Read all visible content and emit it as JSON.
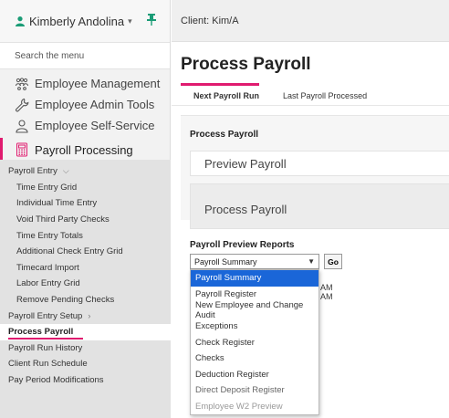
{
  "sidebar": {
    "user_name": "Kimberly Andolina",
    "search_label": "Search the menu",
    "main_items": [
      {
        "label": "Employee Management"
      },
      {
        "label": "Employee Admin Tools"
      },
      {
        "label": "Employee Self-Service"
      },
      {
        "label": "Payroll Processing"
      }
    ],
    "sub_items": [
      {
        "label": "Payroll Entry"
      },
      {
        "label": "Time Entry Grid"
      },
      {
        "label": "Individual Time Entry"
      },
      {
        "label": "Void Third Party Checks"
      },
      {
        "label": "Time Entry Totals"
      },
      {
        "label": "Additional Check Entry Grid"
      },
      {
        "label": "Timecard Import"
      },
      {
        "label": "Labor Entry Grid"
      },
      {
        "label": "Remove Pending Checks"
      },
      {
        "label": "Payroll Entry Setup"
      },
      {
        "label": "Process Payroll"
      },
      {
        "label": "Payroll Run History"
      },
      {
        "label": "Client Run Schedule"
      },
      {
        "label": "Pay Period Modifications"
      }
    ]
  },
  "main": {
    "client": "Client: Kim/A",
    "page_title": "Process Payroll",
    "tabs": [
      {
        "label": "Next Payroll Run"
      },
      {
        "label": "Last Payroll Processed"
      }
    ],
    "section_title": "Process Payroll",
    "preview_button": "Preview Payroll",
    "process_button": "Process Payroll",
    "reports_title": "Payroll Preview Reports",
    "selected_report": "Payroll Summary",
    "go_label": "Go",
    "time_suffix_1": "AM",
    "time_suffix_2": "AM",
    "dropdown_options": [
      {
        "label": "Payroll Summary"
      },
      {
        "label": "Payroll Register"
      },
      {
        "label": "New Employee and Change Audit"
      },
      {
        "label": "Exceptions"
      },
      {
        "label": "Check Register"
      },
      {
        "label": "Checks"
      },
      {
        "label": "Deduction Register"
      },
      {
        "label": "Direct Deposit Register"
      },
      {
        "label": "Employee W2 Preview"
      }
    ]
  },
  "colors": {
    "accent": "#e01b6f",
    "pin": "#1a9c76",
    "selection": "#1a66d8"
  }
}
